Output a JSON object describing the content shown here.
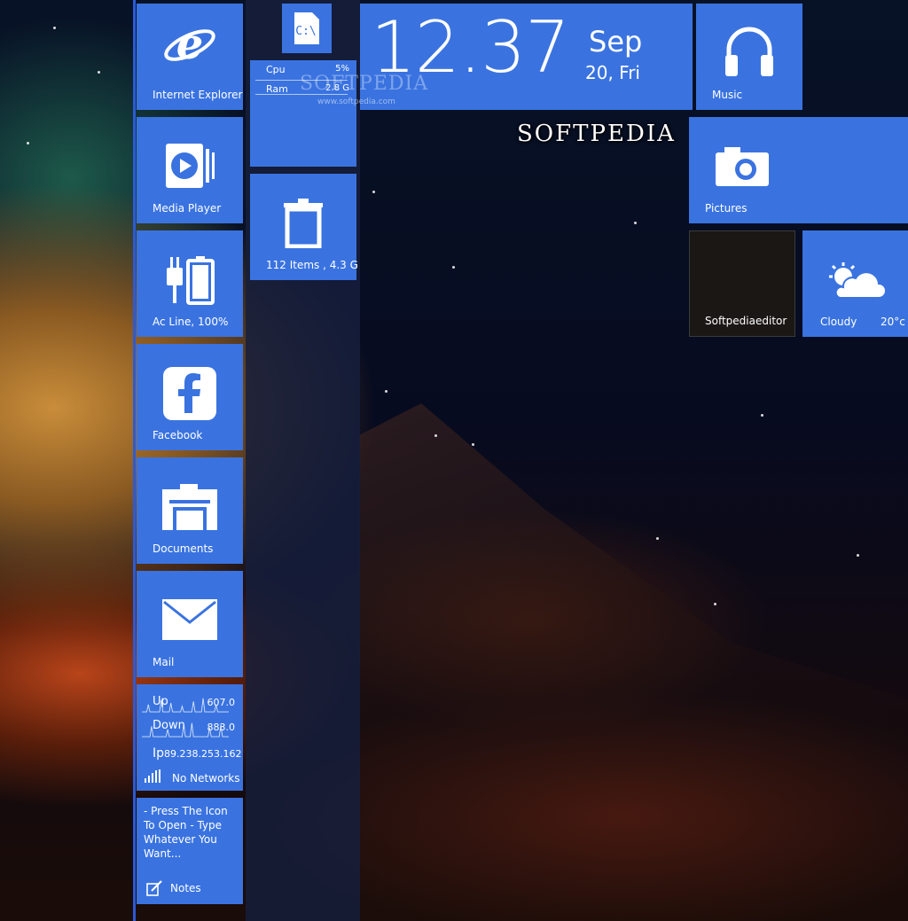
{
  "tiles": {
    "ie": {
      "label": "Internet Explorer"
    },
    "media_player": {
      "label": "Media Player"
    },
    "battery": {
      "label": "Ac Line, 100%"
    },
    "facebook": {
      "label": "Facebook"
    },
    "documents": {
      "label": "Documents"
    },
    "mail": {
      "label": "Mail"
    },
    "drive": {
      "label": "C:\\"
    },
    "system": {
      "cpu_label": "Cpu",
      "cpu_value": "5%",
      "ram_label": "Ram",
      "ram_value": "2.8 G"
    },
    "recycle": {
      "label": "112 Items , 4.3 G"
    },
    "clock": {
      "time": "12.37",
      "month": "Sep",
      "day": "20, Fri"
    },
    "music": {
      "label": "Music"
    },
    "pictures": {
      "label": "Pictures"
    },
    "user": {
      "label": "Softpediaeditor"
    },
    "weather": {
      "condition": "Cloudy",
      "temp": "20°c"
    },
    "network": {
      "up_label": "Up",
      "up_value": "607.0",
      "down_label": "Down",
      "down_value": "883.0",
      "ip_label": "Ip",
      "ip_value": "89.238.253.162",
      "status": "No Networks"
    },
    "notes": {
      "text": "- Press The Icon To Open - Type Whatever You Want...",
      "label": "Notes"
    }
  },
  "watermark": {
    "brand": "SOFTPEDIA",
    "faint": "SOFTPEDIA",
    "url": "www.softpedia.com"
  },
  "colors": {
    "tile": "#3a73e0",
    "panel": "#2a5bd8"
  }
}
